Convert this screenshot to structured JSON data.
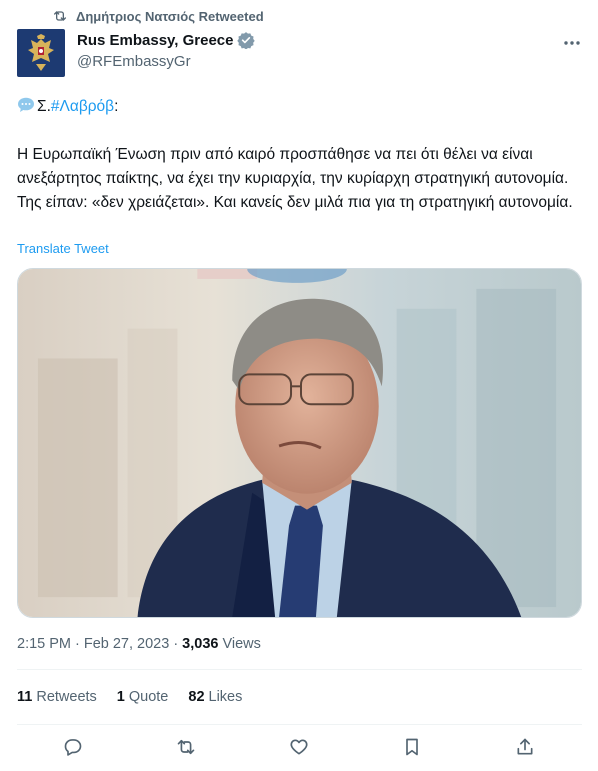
{
  "retweet": {
    "icon": "retweet-icon",
    "retweeter": "Δημήτριος Νατσιός",
    "label": "Retweeted"
  },
  "author": {
    "name": "Rus Embassy, Greece",
    "handle": "@RFEmbassyGr",
    "verified": true,
    "avatar_icon": "coat-of-arms-icon"
  },
  "tweet": {
    "prefix": "Σ.",
    "hashtag": "#Λαβρόβ",
    "suffix": ":",
    "body": "Η Ευρωπαϊκή Ένωση πριν από καιρό προσπάθησε να πει ότι θέλει να είναι ανεξάρτητος παίκτης, να έχει την κυριαρχία, την κυρίαρχη στρατηγική αυτονομία. Της είπαν: «δεν χρειάζεται». Και κανείς δεν μιλά πια για τη στρατηγική αυτονομία.",
    "translate_label": "Translate Tweet"
  },
  "meta": {
    "time": "2:15 PM",
    "separator": "·",
    "date": "Feb 27, 2023",
    "views_count": "3,036",
    "views_label": "Views"
  },
  "stats": {
    "retweets_count": "11",
    "retweets_label": "Retweets",
    "quotes_count": "1",
    "quotes_label": "Quote",
    "likes_count": "82",
    "likes_label": "Likes"
  },
  "actions": [
    "reply-icon",
    "retweet-icon",
    "like-icon",
    "bookmark-icon",
    "share-icon"
  ],
  "colors": {
    "link": "#1d9bf0",
    "secondary": "#536471",
    "primary": "#0f1419",
    "divider": "#eff3f4",
    "avatar_bg": "#1d3a72"
  }
}
